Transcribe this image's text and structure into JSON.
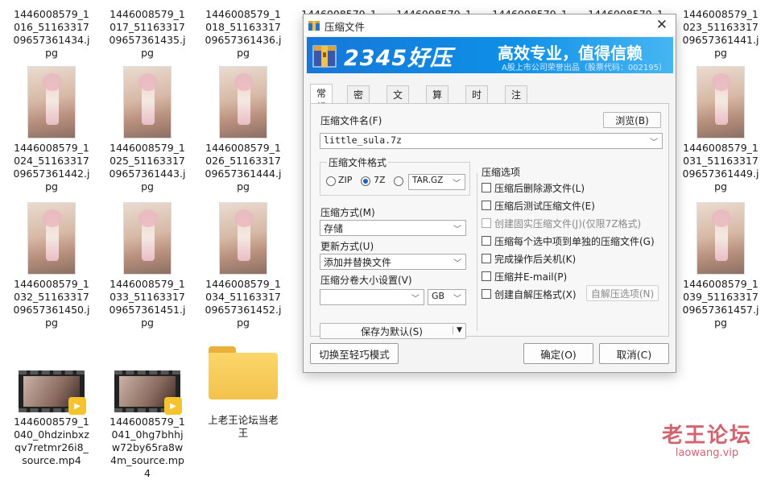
{
  "files": {
    "row0": [
      "1446008579_1016_5116331709657361434.jpg",
      "1446008579_1017_5116331709657361435.jpg",
      "1446008579_1018_5116331709657361436.jpg",
      "1446008579_1",
      "1446008579_1",
      "1446008579_1",
      "1446008579_1",
      "1446008579_1023_5116331709657361441.jpg"
    ],
    "row1": [
      "1446008579_1024_5116331709657361442.jpg",
      "1446008579_1025_5116331709657361443.jpg",
      "1446008579_1026_5116331709657361444.jpg",
      "1446008579_1031_5116331709657361449.jpg"
    ],
    "row2": [
      "1446008579_1032_5116331709657361450.jpg",
      "1446008579_1033_5116331709657361451.jpg",
      "1446008579_1034_5116331709657361452.jpg",
      "1446008579_1039_5116331709657361457.jpg"
    ],
    "videos": [
      "1446008579_1040_0hdzinbxzqv7retmr26i8_source.mp4",
      "1446008579_1041_0hg7bhhjw72by65ra8w4m_source.mp4"
    ],
    "video_badge": "Player",
    "folder": "上老王论坛当老王"
  },
  "dialog": {
    "title": "压缩文件",
    "banner": {
      "brand": "2345好压",
      "slogan": "高效专业，值得信赖",
      "subtext": "A股上市公司荣誉出品（股票代码：002195）"
    },
    "tabs": [
      "常规",
      "密码",
      "文件",
      "算法",
      "时间",
      "注释"
    ],
    "archive_name_label": "压缩文件名(F)",
    "browse_button": "浏览(B)",
    "archive_name_value": "little_sula.7z",
    "format_group_label": "压缩文件格式",
    "formats": [
      {
        "label": "ZIP",
        "checked": false
      },
      {
        "label": "7Z",
        "checked": true
      },
      {
        "label": "",
        "checked": false
      }
    ],
    "format_combo": "TAR.GZ",
    "method_label": "压缩方式(M)",
    "method_value": "存储",
    "update_label": "更新方式(U)",
    "update_value": "添加并替换文件",
    "split_label": "压缩分卷大小设置(V)",
    "split_value": "",
    "split_unit": "GB",
    "save_default": "保存为默认(S)",
    "options_label": "压缩选项",
    "options": [
      {
        "label": "压缩后删除源文件(L)",
        "disabled": false
      },
      {
        "label": "压缩后测试压缩文件(E)",
        "disabled": false
      },
      {
        "label": "创建固实压缩文件(J)(仅限7Z格式)",
        "disabled": true
      },
      {
        "label": "压缩每个选中项到单独的压缩文件(G)",
        "disabled": false
      },
      {
        "label": "完成操作后关机(K)",
        "disabled": false
      },
      {
        "label": "压缩并E-mail(P)",
        "disabled": false
      },
      {
        "label": "创建自解压格式(X)",
        "disabled": false
      }
    ],
    "sfx_options_button": "自解压选项(N)",
    "switch_mode": "切换至轻巧模式",
    "ok": "确定(O)",
    "cancel": "取消(C)"
  },
  "watermark": {
    "title": "老王论坛",
    "url": "laowang.vip"
  },
  "colors": {
    "banner": "#1677d9",
    "radio_checked": "#1565c0",
    "watermark": "#d3626f",
    "folder": "#f3c24c"
  }
}
